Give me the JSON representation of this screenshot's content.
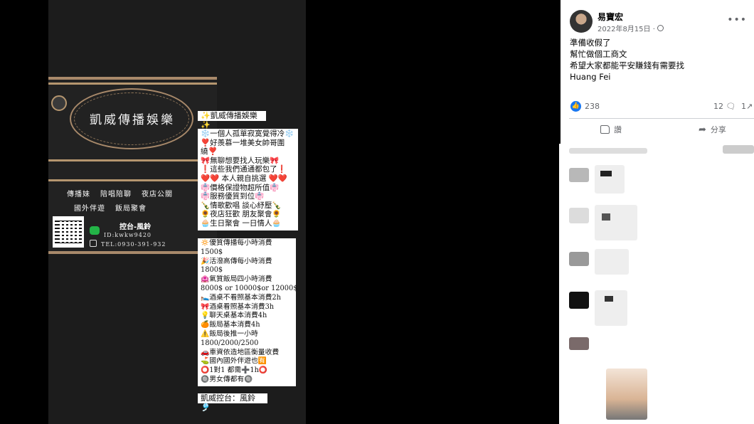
{
  "photo": {
    "brand_title": "凱威傳播娛樂",
    "service_tags_row1": [
      "傳播妹",
      "陪唱陪聊",
      "夜店公關"
    ],
    "service_tags_row2": [
      "國外伴遊",
      "飯局聚會"
    ],
    "console_label": "控台-風鈴",
    "wechat_id": "ID:kwkw9420",
    "tel": "TEL:0930-391-932",
    "card_name": "✨凱威傳播娛樂✨",
    "intro_lines": [
      "❄️一個人孤單寂寞覺得冷❄️",
      "❣️好羨慕一堆美女帥哥圍",
      "繞❣️",
      "🎀無聊想要找人玩樂🎀",
      "❗這些我們通通都包了❗",
      "❤️❤️ 本人親自挑選 ❤️❤️",
      "👘價格保證物超所值👘",
      "👘服務優質到位👘",
      "🍾情歌歡唱 談心紓壓🍾",
      "🌻夜店狂歡 朋友聚會🌻",
      "🧁生日聚會 一日情人🧁"
    ],
    "price_lines": [
      "🔅優質傳播每小時消費",
      "1500$",
      "🎉活潑高傳每小時消費",
      "1800$",
      "🏩氣質飯局四小時消費",
      "8000$ or 10000$or 12000$",
      "🛌酒桌不看照基本消費2h",
      "🎀酒桌看照基本消費3h",
      "💡聊天桌基本消費4h",
      "🍊飯局基本消費4h",
      "⚠️飯局後推一小時",
      "1800/2000/2500",
      "🚗車資依造地區衡量收費",
      "⛳國內國外伴遊也🈶",
      "⭕1對1 都需➕1h⭕",
      "🔘男女傳都有🔘"
    ],
    "card_console": "凱威控台：風鈴🎐"
  },
  "post": {
    "author": "易寶宏",
    "date": "2022年8月15日 ·",
    "body_lines": [
      "準備收假了",
      "幫忙做個工商文",
      "希望大家都能平安賺錢有需要找",
      "Huang Fei"
    ],
    "like_count": "238",
    "comment_count": "12",
    "share_count": "1",
    "like_label": "讚",
    "share_label": "分享",
    "icons": [
      "avatar",
      "globe-icon",
      "more-icon",
      "like-icon",
      "comment-icon",
      "share-icon"
    ]
  },
  "colors": {
    "facebook_blue": "#1877f2",
    "gold": "#b5966f",
    "wechat_green": "#23b447"
  }
}
